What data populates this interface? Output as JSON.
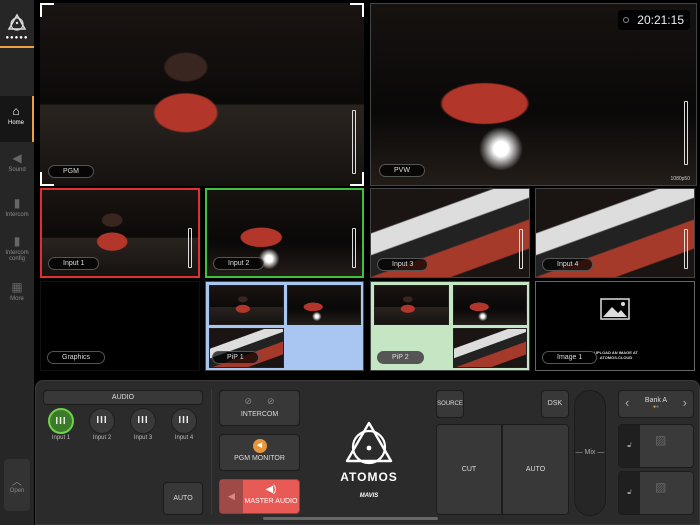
{
  "sidebar": {
    "items": [
      {
        "label": "Home",
        "icon": "home-icon"
      },
      {
        "label": "Sound",
        "icon": "speaker-icon"
      },
      {
        "label": "Intercom",
        "icon": "walkie-talkie-icon"
      },
      {
        "label": "Intercom config",
        "icon": "walkie-config-icon"
      },
      {
        "label": "More",
        "icon": "grid-icon"
      }
    ],
    "open": "Open"
  },
  "clock": "20:21:15",
  "pgm": {
    "label": "PGM"
  },
  "pvw": {
    "label": "PVW",
    "format": "1080p50"
  },
  "inputs": [
    {
      "label": "Input 1"
    },
    {
      "label": "Input 2"
    },
    {
      "label": "Input 3"
    },
    {
      "label": "Input 4"
    }
  ],
  "graphics": {
    "label": "Graphics"
  },
  "pip1": {
    "label": "PiP 1"
  },
  "pip2": {
    "label": "PiP 2"
  },
  "image1": {
    "label": "Image 1",
    "hint": "UPLOAD AN IMAGE AT ATOMOS.CLOUD"
  },
  "audio": {
    "title": "AUDIO",
    "channels": [
      "Input 1",
      "Input 2",
      "Input 3",
      "Input 4"
    ],
    "auto": "AUTO"
  },
  "intercom": {
    "label": "INTERCOM"
  },
  "pgm_monitor": {
    "label": "PGM MONITOR"
  },
  "master_audio": {
    "label": "MASTER AUDIO"
  },
  "brand": {
    "name": "ATOMOS",
    "powered": "MAVIS"
  },
  "switcher": {
    "source": "SOURCE",
    "dsk": "DSK",
    "cut": "CUT",
    "auto": "AUTO",
    "mix": "Mix"
  },
  "bank": {
    "label": "Bank A"
  },
  "colors": {
    "accent": "#f0a040",
    "program": "#e03030",
    "preview": "#40c040",
    "master": "#e85a55"
  }
}
